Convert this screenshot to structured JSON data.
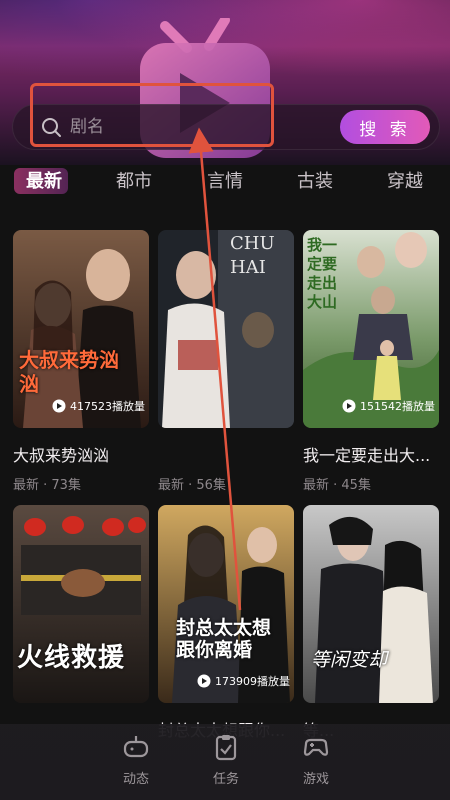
{
  "search": {
    "placeholder": "剧名",
    "button_label": "搜 索"
  },
  "tabs": [
    {
      "label": "最新",
      "active": true
    },
    {
      "label": "都市",
      "active": false
    },
    {
      "label": "言情",
      "active": false
    },
    {
      "label": "古装",
      "active": false
    },
    {
      "label": "穿越",
      "active": false
    }
  ],
  "cards": [
    {
      "title": "大叔来势汹汹",
      "meta": "最新 · 73集",
      "plays": "417523播放量",
      "poster_text": "大叔来势汹汹"
    },
    {
      "title": "",
      "meta": "最新 · 56集",
      "plays": "",
      "poster_text": "CHU HAI"
    },
    {
      "title": "我一定要走出大...",
      "meta": "最新 · 45集",
      "plays": "151542播放量",
      "poster_text": "我一定要走出大山"
    },
    {
      "title": "",
      "meta": "",
      "plays": "",
      "poster_text": "火线救援"
    },
    {
      "title": "封总太太想跟你...",
      "meta": "",
      "plays": "173909播放量",
      "poster_text": "封总太太想跟你离婚"
    },
    {
      "title": "等...",
      "meta": "",
      "plays": "",
      "poster_text": "等闲变却"
    }
  ],
  "bottom_nav": [
    {
      "label": "动态",
      "icon": "gamepad-icon"
    },
    {
      "label": "任务",
      "icon": "clipboard-check-icon"
    },
    {
      "label": "游戏",
      "icon": "controller-icon"
    }
  ],
  "colors": {
    "accent": "#e25ab8",
    "annotation": "#e0533d"
  }
}
